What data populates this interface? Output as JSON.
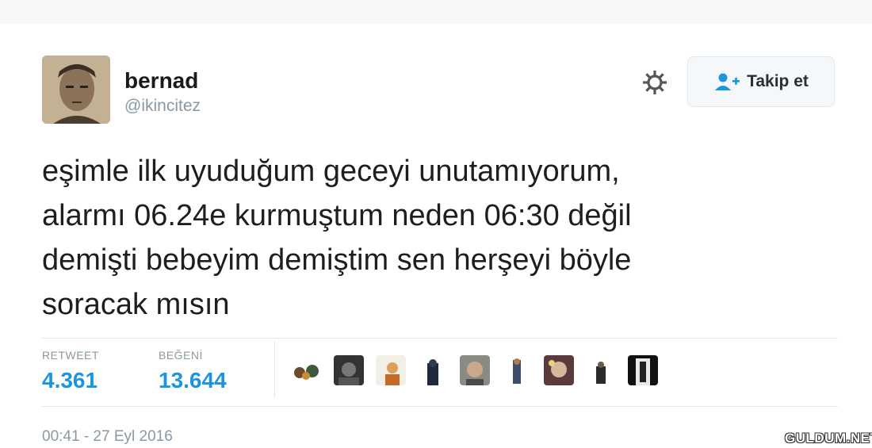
{
  "user": {
    "display_name": "bernad",
    "handle": "@ikincitez"
  },
  "actions": {
    "follow_label": "Takip et",
    "settings_icon": "gear-icon",
    "follow_icon": "add-user-icon"
  },
  "tweet": {
    "lines": [
      "eşimle ilk uyuduğum geceyi unutamıyorum,",
      "alarmı 06.24e kurmuştum neden 06:30 değil",
      "demişti bebeyim demiştim sen herşeyi böyle",
      "soracak mısın"
    ]
  },
  "stats": {
    "retweet_label": "RETWEET",
    "retweet_count": "4.361",
    "like_label": "BEĞENİ",
    "like_count": "13.644"
  },
  "timestamp": "00:41 - 27 Eyl 2016",
  "watermark": "GULDUM.NET",
  "colors": {
    "stat_value": "#1b95e0",
    "muted": "#8899a6",
    "border": "#e1e8ed"
  }
}
